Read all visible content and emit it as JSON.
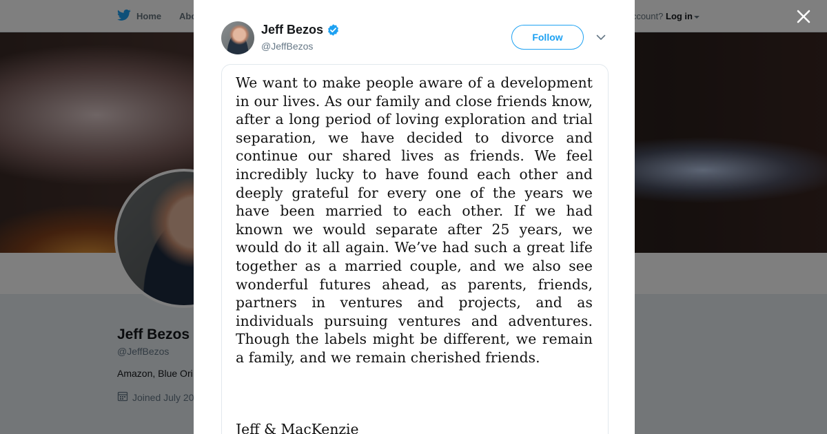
{
  "nav": {
    "home_label": "Home",
    "about_label": "Abo",
    "account_prompt": "ccount?",
    "login_label": "Log in"
  },
  "profile": {
    "name": "Jeff Bezos",
    "handle": "@JeffBezos",
    "bio": "Amazon, Blue Ori",
    "joined": "Joined July 20"
  },
  "tweet": {
    "author_name": "Jeff Bezos",
    "author_handle": "@JeffBezos",
    "follow_label": "Follow",
    "statement": "We want to make people aware of a development in our lives. As our family and close friends know, after a long period of loving exploration and trial separation, we have decided to divorce and continue our shared lives as friends.  We feel incredibly lucky to have found each other and deeply grateful for every one of the years we have been married to each other.  If we had known we would separate after 25 years, we would do it all again.  We’ve had such a great life together as a married couple, and we also see wonderful futures ahead, as parents, friends, partners in ventures and projects, and as individuals pursuing ventures and adventures.  Though the labels might be different, we remain a family, and we remain cherished friends.",
    "signature": "Jeff & MacKenzie"
  },
  "colors": {
    "brand": "#1da1f2",
    "overlay": "rgba(0,0,0,0.5)"
  },
  "icons": [
    "twitter-bird-icon",
    "verified-badge-icon",
    "chevron-down-icon",
    "close-icon",
    "calendar-icon"
  ]
}
